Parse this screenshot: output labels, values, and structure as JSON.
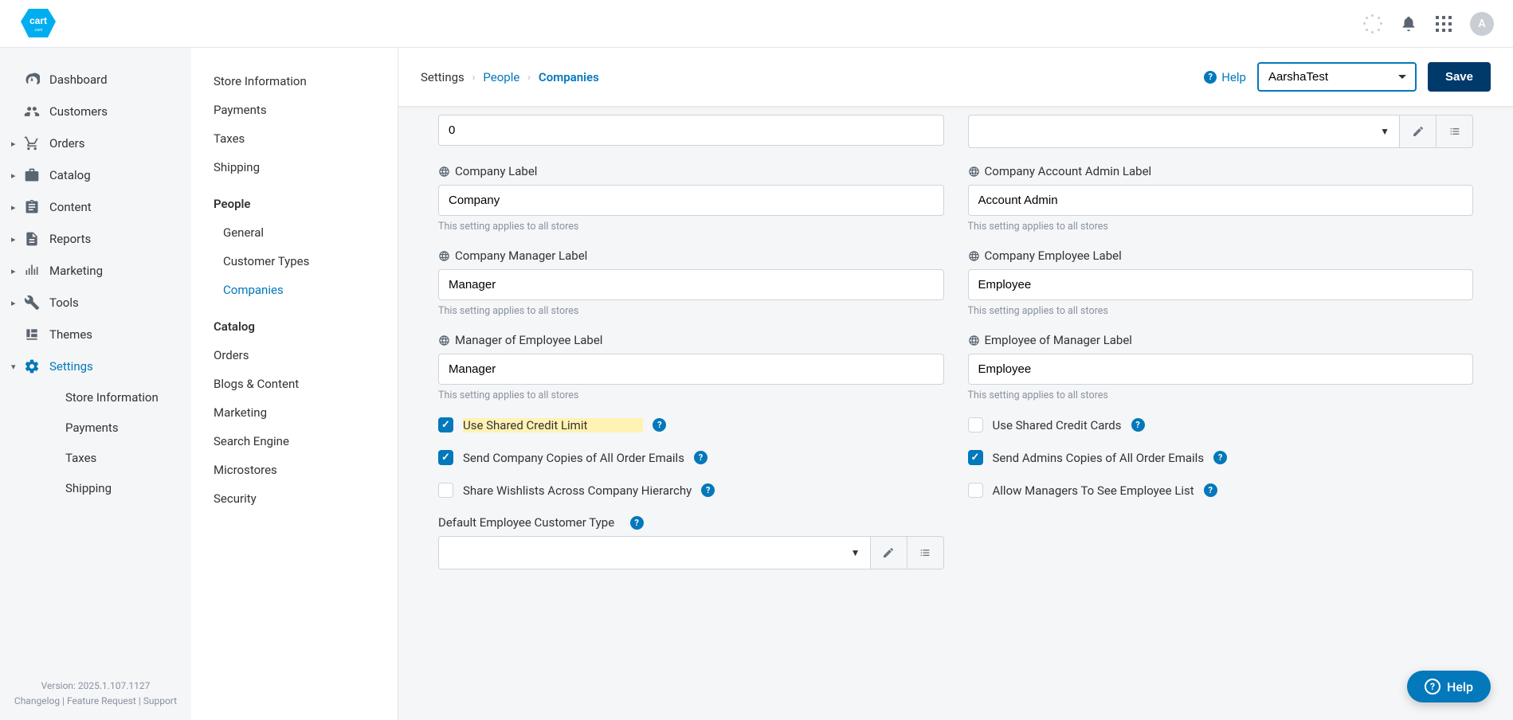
{
  "topbar": {
    "avatar_initial": "A"
  },
  "nav_main": {
    "items": [
      {
        "label": "Dashboard"
      },
      {
        "label": "Customers"
      },
      {
        "label": "Orders"
      },
      {
        "label": "Catalog"
      },
      {
        "label": "Content"
      },
      {
        "label": "Reports"
      },
      {
        "label": "Marketing"
      },
      {
        "label": "Tools"
      },
      {
        "label": "Themes"
      },
      {
        "label": "Settings"
      }
    ],
    "settings_sub": [
      {
        "label": "Store Information"
      },
      {
        "label": "Payments"
      },
      {
        "label": "Taxes"
      },
      {
        "label": "Shipping"
      }
    ],
    "footer": {
      "version": "Version: 2025.1.107.1127",
      "links": "Changelog | Feature Request | Support"
    }
  },
  "nav_sub": {
    "store_information": "Store Information",
    "payments": "Payments",
    "taxes": "Taxes",
    "shipping": "Shipping",
    "people": "People",
    "general": "General",
    "customer_types": "Customer Types",
    "companies": "Companies",
    "catalog": "Catalog",
    "orders": "Orders",
    "blogs": "Blogs & Content",
    "marketing": "Marketing",
    "search_engine": "Search Engine",
    "microstores": "Microstores",
    "security": "Security"
  },
  "header": {
    "crumb_root": "Settings",
    "crumb_people": "People",
    "crumb_current": "Companies",
    "help_label": "Help",
    "store_selected": "AarshaTest",
    "save_label": "Save"
  },
  "form": {
    "zero_value": "0",
    "company_label": "Company Label",
    "company_value": "Company",
    "account_admin_label": "Company Account Admin Label",
    "account_admin_value": "Account Admin",
    "manager_label": "Company Manager Label",
    "manager_value": "Manager",
    "employee_label": "Company Employee Label",
    "employee_value": "Employee",
    "mgr_of_emp_label": "Manager of Employee Label",
    "mgr_of_emp_value": "Manager",
    "emp_of_mgr_label": "Employee of Manager Label",
    "emp_of_mgr_value": "Employee",
    "applies_helper": "This setting applies to all stores",
    "cb_shared_credit_limit": "Use Shared Credit Limit",
    "cb_shared_credit_cards": "Use Shared Credit Cards",
    "cb_company_copies": "Send Company Copies of All Order Emails",
    "cb_admin_copies": "Send Admins Copies of All Order Emails",
    "cb_share_wishlists": "Share Wishlists Across Company Hierarchy",
    "cb_allow_managers": "Allow Managers To See Employee List",
    "default_emp_ct_label": "Default Employee Customer Type"
  },
  "float_help": "Help"
}
